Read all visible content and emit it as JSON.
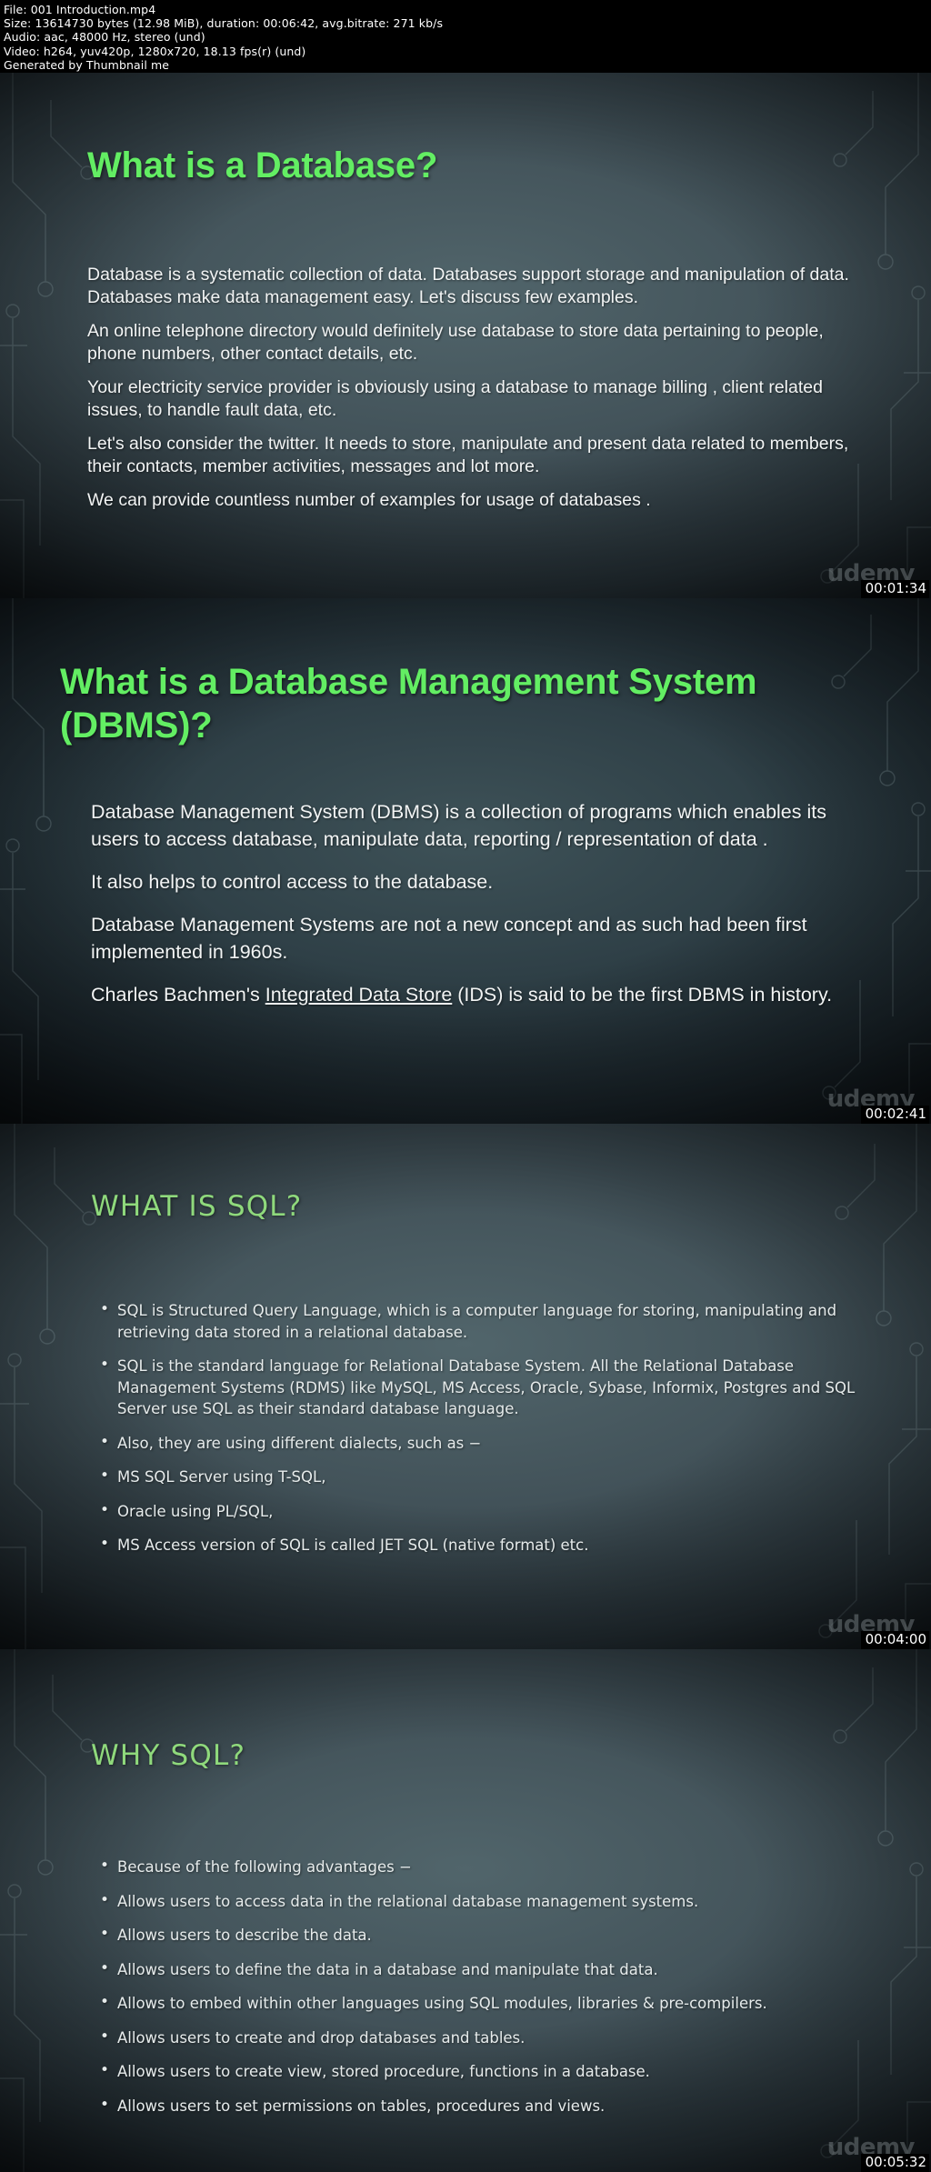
{
  "info_header": {
    "lines": [
      "File: 001 Introduction.mp4",
      "Size: 13614730 bytes (12.98 MiB), duration: 00:06:42, avg.bitrate: 271 kb/s",
      "Audio: aac, 48000 Hz, stereo (und)",
      "Video: h264, yuv420p, 1280x720, 18.13 fps(r) (und)",
      "Generated by Thumbnail me"
    ]
  },
  "colors": {
    "title_green_a": "#63ee63",
    "title_green_b": "#8fd97c",
    "body_text": "#f2f4f4",
    "background_dark": "#0d1318",
    "header_bg": "#000000"
  },
  "watermark": "udemy",
  "slides": [
    {
      "title": "What is a Database?",
      "timecode": "00:01:34",
      "paragraphs": [
        "Database is a systematic collection of data. Databases support storage and  manipulation of data. Databases make data management easy. Let's discuss few examples.",
        "An online telephone directory would definitely use database to store data pertaining to people, phone numbers, other contact details, etc.",
        "Your electricity service provider is obviously using a database to manage billing , client related issues, to handle fault data, etc.",
        "Let's also consider the twitter. It needs to store, manipulate and present data related to members, their contacts, member activities, messages and lot more.",
        "We can provide countless number of examples for usage of databases ."
      ]
    },
    {
      "title": "What is a Database Management System (DBMS)?",
      "timecode": "00:02:41",
      "paragraphs": [
        "Database Management System (DBMS) is a collection of programs which enables its users to access database, manipulate data, reporting / representation of  data .",
        "It also helps to control access to the  database.",
        "Database Management Systems are not a new concept and as such had been first implemented in 1960s."
      ],
      "last_paragraph": {
        "before": "Charles Bachmen's ",
        "underlined": "Integrated Data Store",
        "after": " (IDS) is said to be the first DBMS in history."
      }
    },
    {
      "title": "WHAT IS SQL?",
      "timecode": "00:04:00",
      "bullets": [
        "SQL is Structured Query Language, which is a computer language for storing, manipulating and retrieving data stored in a relational database.",
        "SQL is the standard language for Relational Database System. All the Relational Database Management Systems (RDMS) like MySQL, MS Access, Oracle, Sybase, Informix, Postgres and SQL Server use SQL as their standard database language.",
        "Also, they are using different dialects, such as −",
        "MS SQL Server using T-SQL,",
        "Oracle using PL/SQL,",
        "MS Access version of SQL is called JET SQL (native format) etc."
      ]
    },
    {
      "title": "WHY SQL?",
      "timecode": "00:05:32",
      "bullets": [
        "Because of the following advantages −",
        "Allows users to access data in the relational database management systems.",
        "Allows users to describe the data.",
        "Allows users to define the data in a database and manipulate that data.",
        "Allows to embed within other languages using SQL modules, libraries & pre-compilers.",
        "Allows users to create and drop databases and tables.",
        "Allows users to create view, stored procedure, functions in a database.",
        "Allows users to set permissions on tables, procedures and views."
      ]
    }
  ]
}
